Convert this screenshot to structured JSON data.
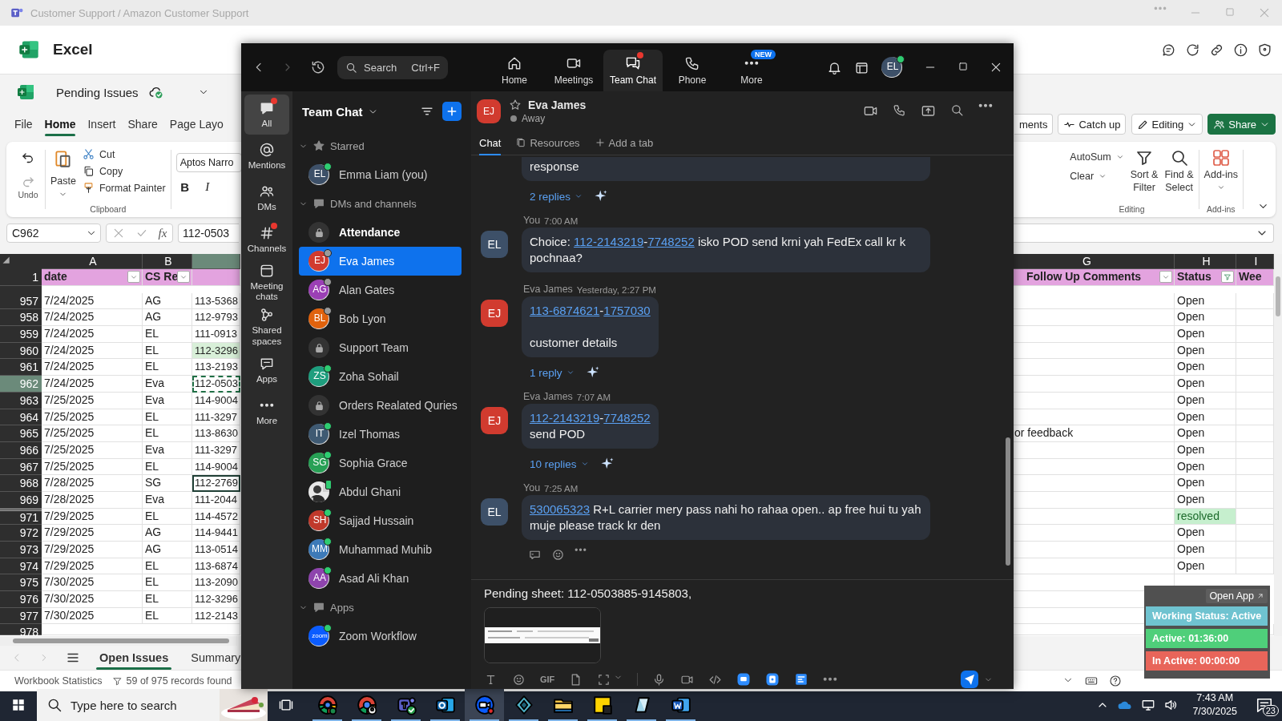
{
  "excel": {
    "window_title": "Customer Support / Amazon Customer Support",
    "app_name": "Excel",
    "file_name": "Pending Issues",
    "tabs": [
      {
        "label": "File",
        "selected": false
      },
      {
        "label": "Home",
        "selected": true
      },
      {
        "label": "Insert",
        "selected": false
      },
      {
        "label": "Share",
        "selected": false
      },
      {
        "label": "Page Layo",
        "selected": false
      }
    ],
    "actions": [
      {
        "label": "ments",
        "kind": "plain"
      },
      {
        "label": "Catch up",
        "kind": "catch-up"
      },
      {
        "label": "Editing",
        "kind": "editing"
      },
      {
        "label": "Share",
        "kind": "share"
      }
    ],
    "ribbon": {
      "undo_group": "Undo",
      "paste": "Paste",
      "cut": "Cut",
      "copy": "Copy",
      "format_painter": "Format Painter",
      "clipboard_group": "Clipboard",
      "font": "Aptos Narro",
      "bold": "B",
      "italic": "I",
      "autosum": "AutoSum",
      "clear": "Clear",
      "sort_filter": [
        "Sort &",
        "Filter"
      ],
      "find_select": [
        "Find &",
        "Select"
      ],
      "editing_group": "Editing",
      "add_ins": "Add-ins",
      "add_ins_group": "Add-ins"
    },
    "name_box": "C962",
    "fx": "fx",
    "formula": "112-0503",
    "columns_left": [
      "A",
      "B"
    ],
    "columns_right": [
      "G",
      "H",
      "I"
    ],
    "header_row": {
      "number": "1",
      "date": "date",
      "rep": "CS Re",
      "follow_up": "Follow Up Comments",
      "status": "Status",
      "week": "Wee"
    },
    "rows": [
      {
        "number": "957",
        "date": "7/24/2025",
        "rep": "AG",
        "order": {
          "text": "113-5368",
          "kind": "plain"
        },
        "selected": false,
        "hidden_above": false,
        "status": "Open",
        "status_highlighted": false
      },
      {
        "number": "958",
        "date": "7/24/2025",
        "rep": "AG",
        "order": {
          "text": "112-9793",
          "kind": "plain"
        },
        "selected": false,
        "hidden_above": false,
        "status": "Open",
        "status_highlighted": false
      },
      {
        "number": "959",
        "date": "7/24/2025",
        "rep": "EL",
        "order": {
          "text": "111-0913",
          "kind": "plain"
        },
        "selected": false,
        "hidden_above": false,
        "status": "Open",
        "status_highlighted": false
      },
      {
        "number": "960",
        "date": "7/24/2025",
        "rep": "EL",
        "order": {
          "text": "112-3296",
          "kind": "highlighted"
        },
        "selected": false,
        "hidden_above": false,
        "status": "Open",
        "status_highlighted": false
      },
      {
        "number": "961",
        "date": "7/24/2025",
        "rep": "EL",
        "order": {
          "text": "113-2193",
          "kind": "plain"
        },
        "selected": false,
        "hidden_above": false,
        "status": "Open",
        "status_highlighted": false
      },
      {
        "number": "962",
        "date": "7/24/2025",
        "rep": "Eva",
        "order": {
          "text": "112-0503",
          "kind": "copied"
        },
        "selected": true,
        "hidden_above": false,
        "status": "Open",
        "status_highlighted": false
      },
      {
        "number": "963",
        "date": "7/25/2025",
        "rep": "Eva",
        "order": {
          "text": "114-9004",
          "kind": "plain"
        },
        "selected": false,
        "hidden_above": false,
        "status": "Open",
        "status_highlighted": false
      },
      {
        "number": "964",
        "date": "7/25/2025",
        "rep": "EL",
        "order": {
          "text": "111-3297",
          "kind": "plain"
        },
        "selected": false,
        "hidden_above": false,
        "status": "Open",
        "status_highlighted": false
      },
      {
        "number": "965",
        "date": "7/25/2025",
        "rep": "EL",
        "order": {
          "text": "113-8630",
          "kind": "plain"
        },
        "selected": false,
        "hidden_above": false,
        "follow_up": "or feedback",
        "status": "Open",
        "status_highlighted": false
      },
      {
        "number": "966",
        "date": "7/25/2025",
        "rep": "Eva",
        "order": {
          "text": "111-3297",
          "kind": "plain"
        },
        "selected": false,
        "hidden_above": false,
        "status": "Open",
        "status_highlighted": false
      },
      {
        "number": "967",
        "date": "7/25/2025",
        "rep": "EL",
        "order": {
          "text": "114-9004",
          "kind": "plain"
        },
        "selected": false,
        "hidden_above": false,
        "status": "Open",
        "status_highlighted": false
      },
      {
        "number": "968",
        "date": "7/28/2025",
        "rep": "SG",
        "order": {
          "text": "112-2769",
          "kind": "active"
        },
        "selected": false,
        "hidden_above": false,
        "status": "Open",
        "status_highlighted": false
      },
      {
        "number": "969",
        "date": "7/28/2025",
        "rep": "Eva",
        "order": {
          "text": "111-2044",
          "kind": "plain"
        },
        "selected": false,
        "hidden_above": false,
        "status": "Open",
        "status_highlighted": false
      },
      {
        "number": "971",
        "date": "7/29/2025",
        "rep": "EL",
        "order": {
          "text": "114-4572",
          "kind": "plain"
        },
        "selected": false,
        "hidden_above": true,
        "status": "resolved",
        "status_highlighted": true
      },
      {
        "number": "972",
        "date": "7/29/2025",
        "rep": "AG",
        "order": {
          "text": "114-9441",
          "kind": "plain"
        },
        "selected": false,
        "hidden_above": false,
        "status": "Open",
        "status_highlighted": false
      },
      {
        "number": "973",
        "date": "7/29/2025",
        "rep": "AG",
        "order": {
          "text": "113-0514",
          "kind": "plain"
        },
        "selected": false,
        "hidden_above": false,
        "status": "Open",
        "status_highlighted": false
      },
      {
        "number": "974",
        "date": "7/29/2025",
        "rep": "EL",
        "order": {
          "text": "113-6874",
          "kind": "plain"
        },
        "selected": false,
        "hidden_above": false,
        "status": "Open",
        "status_highlighted": false
      },
      {
        "number": "975",
        "date": "7/30/2025",
        "rep": "EL",
        "order": {
          "text": "113-2090",
          "kind": "plain"
        },
        "selected": false,
        "hidden_above": false
      },
      {
        "number": "976",
        "date": "7/30/2025",
        "rep": "EL",
        "order": {
          "text": "112-3296",
          "kind": "plain"
        },
        "selected": false,
        "hidden_above": false
      },
      {
        "number": "977",
        "date": "7/30/2025",
        "rep": "EL",
        "order": {
          "text": "112-2143",
          "kind": "plain"
        },
        "selected": false,
        "hidden_above": false
      }
    ],
    "last_row_number": "978",
    "sheet_tabs": [
      {
        "label": "Open Issues",
        "selected": true
      },
      {
        "label": "Summary",
        "selected": false
      }
    ],
    "status_bar": {
      "stats": "Workbook Statistics",
      "records": "59 of 975 records found"
    }
  },
  "zoom": {
    "nav": {
      "search": "Search",
      "shortcut": "Ctrl+F",
      "tabs": [
        {
          "label": "Home",
          "kind": "home",
          "selected": false,
          "alert": false
        },
        {
          "label": "Meetings",
          "kind": "meetings",
          "selected": false,
          "alert": false
        },
        {
          "label": "Team Chat",
          "kind": "chat",
          "selected": true,
          "alert": true
        },
        {
          "label": "Phone",
          "kind": "phone",
          "selected": false,
          "alert": false
        },
        {
          "label": "More",
          "kind": "more",
          "selected": false,
          "alert": false,
          "badge": "NEW"
        }
      ],
      "avatar": {
        "initials": "EL",
        "color": "#3d5068",
        "presence": {
          "kind": "online"
        }
      }
    },
    "rail": [
      {
        "label": "All",
        "kind": "all",
        "selected": true,
        "alert": true
      },
      {
        "label": "Mentions",
        "kind": "mentions",
        "selected": false,
        "alert": false
      },
      {
        "label": "DMs",
        "kind": "dms",
        "selected": false,
        "alert": false
      },
      {
        "label": "Channels",
        "kind": "channels",
        "selected": false,
        "alert": true
      },
      {
        "label": "Meeting chats",
        "kind": "meetings",
        "selected": false,
        "alert": false
      },
      {
        "label": "Shared spaces",
        "kind": "spaces",
        "selected": false,
        "alert": false
      },
      {
        "label": "Apps",
        "kind": "apps",
        "selected": false,
        "alert": false
      },
      {
        "label": "More",
        "kind": "more",
        "selected": false,
        "alert": false
      }
    ],
    "chat_list": {
      "title": "Team Chat",
      "sections": [
        {
          "label": "Starred",
          "kind": "star",
          "expanded": true,
          "items": [
            {
              "name": "Emma Liam (you)",
              "kind": "avatar",
              "initials": "EL",
              "color": "#3d5068",
              "presence": {
                "kind": "online"
              },
              "selected": false,
              "unread": false
            }
          ]
        },
        {
          "label": "DMs and channels",
          "kind": "chat",
          "expanded": true,
          "items": [
            {
              "name": "Attendance",
              "kind": "channel",
              "selected": false,
              "unread": true
            },
            {
              "name": "Eva James",
              "kind": "avatar",
              "initials": "EJ",
              "color": "#d13b2f",
              "presence": {
                "kind": "away"
              },
              "selected": true,
              "unread": false
            },
            {
              "name": "Alan Gates",
              "kind": "avatar",
              "initials": "AG",
              "color": "#9b3fb5",
              "presence": {
                "kind": "away"
              },
              "selected": false,
              "unread": false
            },
            {
              "name": "Bob Lyon",
              "kind": "avatar",
              "initials": "BL",
              "color": "#e0620d",
              "presence": {
                "kind": "away"
              },
              "selected": false,
              "unread": false
            },
            {
              "name": "Support Team",
              "kind": "channel",
              "selected": false,
              "unread": false
            },
            {
              "name": "Zoha Sohail",
              "kind": "avatar",
              "initials": "ZS",
              "color": "#1e9e7e",
              "presence": {
                "kind": "online"
              },
              "selected": false,
              "unread": false
            },
            {
              "name": "Orders Realated Quries",
              "kind": "channel",
              "selected": false,
              "unread": false
            },
            {
              "name": "Izel Thomas",
              "kind": "avatar",
              "initials": "IT",
              "color": "#3f5a73",
              "presence": {
                "kind": "online"
              },
              "selected": false,
              "unread": false
            },
            {
              "name": "Sophia Grace",
              "kind": "avatar",
              "initials": "SG",
              "color": "#27a055",
              "presence": {
                "kind": "online"
              },
              "selected": false,
              "unread": false
            },
            {
              "name": "Abdul Ghani",
              "presence": {
                "kind": "mobile"
              },
              "selected": false,
              "unread": false
            },
            {
              "name": "Sajjad Hussain",
              "kind": "avatar",
              "initials": "SH",
              "color": "#c0392b",
              "presence": {
                "kind": "online"
              },
              "selected": false,
              "unread": false
            },
            {
              "name": "Muhammad Muhib",
              "kind": "avatar",
              "initials": "MM",
              "color": "#3d7ab8",
              "presence": {
                "kind": "online"
              },
              "selected": false,
              "unread": false
            },
            {
              "name": "Asad Ali Khan",
              "kind": "avatar",
              "initials": "AA",
              "color": "#8e44ad",
              "presence": {
                "kind": "online"
              },
              "selected": false,
              "unread": false
            }
          ]
        },
        {
          "label": "Apps",
          "kind": "chat",
          "expanded": true,
          "items": [
            {
              "name": "Zoom Workflow",
              "kind": "app",
              "initials": "zoom",
              "color": "#0b5cff",
              "presence": {
                "kind": "online"
              },
              "selected": false,
              "unread": false
            }
          ]
        }
      ]
    },
    "conversation": {
      "contact": {
        "initials": "EJ",
        "color": "#d13b2f",
        "name": "Eva James",
        "status": "Away",
        "starred": false
      },
      "tabs": [
        {
          "label": "Chat",
          "kind": "chat",
          "selected": true
        },
        {
          "label": "Resources",
          "kind": "resources",
          "selected": false
        },
        {
          "label": "Add a tab",
          "kind": "add",
          "selected": false
        }
      ],
      "messages": [
        {
          "continued": true,
          "segments": [
            {
              "kind": "text",
              "text": "response"
            }
          ],
          "replies": "2 replies",
          "actions": false
        },
        {
          "continued": false,
          "sender": "You",
          "time": "7:00 AM",
          "initials": "EL",
          "color": "#3d5068",
          "segments": [
            {
              "kind": "text",
              "text": "Choice: "
            },
            {
              "kind": "link",
              "text": "112-2143219"
            },
            {
              "kind": "text",
              "text": "-"
            },
            {
              "kind": "link",
              "text": "7748252"
            },
            {
              "kind": "text",
              "text": " isko POD send krni yah FedEx call kr k pochnaa?"
            }
          ],
          "actions": false
        },
        {
          "continued": false,
          "sender": "Eva James",
          "time": "Yesterday, 2:27 PM",
          "initials": "EJ",
          "color": "#d13b2f",
          "segments": [
            {
              "kind": "link",
              "text": "113-6874621"
            },
            {
              "kind": "text",
              "text": "-"
            },
            {
              "kind": "link",
              "text": "1757030"
            },
            {
              "kind": "text",
              "text": "\n\ncustomer details"
            }
          ],
          "replies": "1 reply",
          "actions": false
        },
        {
          "continued": false,
          "sender": "Eva James",
          "time": "7:07 AM",
          "initials": "EJ",
          "color": "#d13b2f",
          "segments": [
            {
              "kind": "link",
              "text": "112-2143219"
            },
            {
              "kind": "text",
              "text": "-"
            },
            {
              "kind": "link",
              "text": "7748252"
            },
            {
              "kind": "text",
              "text": "\nsend POD"
            }
          ],
          "replies": "10 replies",
          "actions": false
        },
        {
          "continued": false,
          "sender": "You",
          "time": "7:25 AM",
          "initials": "EL",
          "color": "#3d5068",
          "segments": [
            {
              "kind": "link",
              "text": "530065323"
            },
            {
              "kind": "text",
              "text": " R+L carrier mery pass nahi ho rahaa open.. ap free hui tu yah muje please track kr den"
            }
          ],
          "actions": true
        }
      ],
      "compose": {
        "text": "Pending sheet: 112-0503885-9145803,",
        "gif": "GIF"
      }
    }
  },
  "tracker": {
    "open_app": "Open App",
    "working_status": "Working Status: Active",
    "active": "Active: 01:36:00",
    "inactive": "In Active: 00:00:00"
  },
  "taskbar": {
    "placeholder": "Type here to search",
    "apps": [
      {
        "kind": "chrome",
        "selected": false
      },
      {
        "kind": "chrome-profile",
        "selected": false
      },
      {
        "kind": "teams",
        "selected": false
      },
      {
        "kind": "outlook",
        "selected": false
      },
      {
        "kind": "zoom",
        "selected": true
      },
      {
        "kind": "diamond",
        "selected": false
      },
      {
        "kind": "folder",
        "selected": false
      },
      {
        "kind": "sticky",
        "selected": false
      },
      {
        "kind": "crystal",
        "selected": false
      },
      {
        "kind": "word",
        "selected": false
      }
    ],
    "time": "7:43 AM",
    "date": "7/30/2025",
    "notifications": "23"
  }
}
